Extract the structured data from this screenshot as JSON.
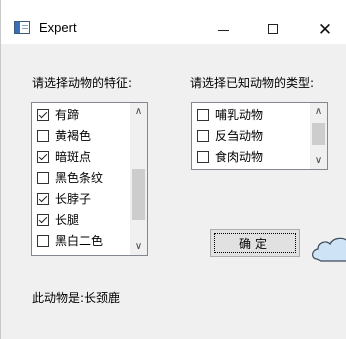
{
  "window": {
    "title": "Expert",
    "minimize_glyph": "",
    "maximize_glyph": "",
    "close_glyph": "✕"
  },
  "features": {
    "label": "请选择动物的特征:",
    "items": [
      {
        "label": "有蹄",
        "checked": true
      },
      {
        "label": "黄褐色",
        "checked": false
      },
      {
        "label": "暗斑点",
        "checked": true
      },
      {
        "label": "黑色条纹",
        "checked": false
      },
      {
        "label": "长脖子",
        "checked": true
      },
      {
        "label": "长腿",
        "checked": true
      },
      {
        "label": "黑白二色",
        "checked": false
      }
    ]
  },
  "types": {
    "label": "请选择已知动物的类型:",
    "items": [
      {
        "label": "哺乳动物",
        "checked": false
      },
      {
        "label": "反刍动物",
        "checked": false
      },
      {
        "label": "食肉动物",
        "checked": false
      }
    ]
  },
  "ok_button": {
    "label": "确定"
  },
  "result": {
    "text": "此动物是:长颈鹿"
  },
  "icons": {
    "app": "window-app-icon",
    "scroll_up": "chevron-up-icon",
    "scroll_down": "chevron-down-icon",
    "decoration": "cloud-shape-icon"
  }
}
